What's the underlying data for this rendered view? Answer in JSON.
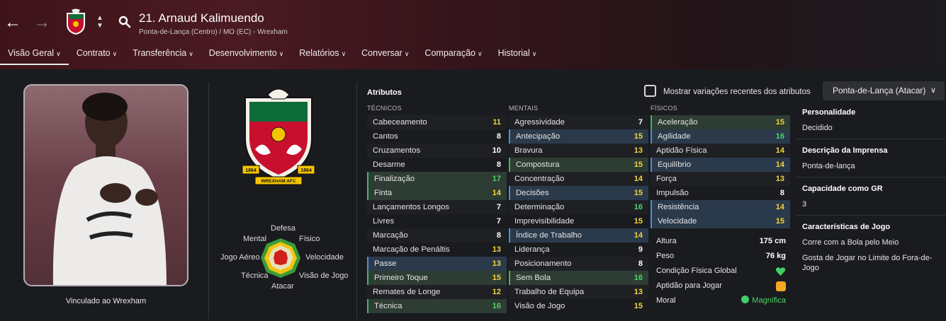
{
  "header": {
    "player_name": "21. Arnaud Kalimuendo",
    "subtitle": "Ponta-de-Lança (Centro) / MO (EC) - Wrexham",
    "back_icon": "back-arrow-icon",
    "forward_icon": "forward-arrow-icon",
    "search_icon": "search-icon"
  },
  "tabs": [
    {
      "label": "Visão Geral"
    },
    {
      "label": "Contrato"
    },
    {
      "label": "Transferência"
    },
    {
      "label": "Desenvolvimento"
    },
    {
      "label": "Relatórios"
    },
    {
      "label": "Conversar"
    },
    {
      "label": "Comparação"
    },
    {
      "label": "Historial"
    }
  ],
  "profile": {
    "caption": "Vinculado ao Wrexham",
    "crest_text": "WREXHAM AFC",
    "crest_years_left": "1864",
    "crest_years_right": "1864"
  },
  "radar": {
    "labels": {
      "defesa": "Defesa",
      "fisico": "Físico",
      "velocidade": "Velocidade",
      "visao": "Visão de Jogo",
      "atacar": "Atacar",
      "tecnica": "Técnica",
      "jogo_aereo": "Jogo Aéreo",
      "mental": "Mental"
    }
  },
  "attributes": {
    "title": "Atributos",
    "show_recent_label": "Mostrar variações recentes dos atributos",
    "role_dropdown": "Ponta-de-Lança (Atacar)",
    "technical_header": "TÉCNICOS",
    "mental_header": "MENTAIS",
    "physical_header": "FÍSICOS",
    "technical": [
      {
        "name": "Cabeceamento",
        "value": "11",
        "color": "yellow",
        "hl": ""
      },
      {
        "name": "Cantos",
        "value": "8",
        "color": "white",
        "hl": ""
      },
      {
        "name": "Cruzamentos",
        "value": "10",
        "color": "white",
        "hl": ""
      },
      {
        "name": "Desarme",
        "value": "8",
        "color": "white",
        "hl": ""
      },
      {
        "name": "Finalização",
        "value": "17",
        "color": "green",
        "hl": "g"
      },
      {
        "name": "Finta",
        "value": "14",
        "color": "yellow",
        "hl": "g"
      },
      {
        "name": "Lançamentos Longos",
        "value": "7",
        "color": "white",
        "hl": ""
      },
      {
        "name": "Livres",
        "value": "7",
        "color": "white",
        "hl": ""
      },
      {
        "name": "Marcação",
        "value": "8",
        "color": "white",
        "hl": ""
      },
      {
        "name": "Marcação de Penáltis",
        "value": "13",
        "color": "yellow",
        "hl": ""
      },
      {
        "name": "Passe",
        "value": "13",
        "color": "yellow",
        "hl": "b"
      },
      {
        "name": "Primeiro Toque",
        "value": "15",
        "color": "yellow",
        "hl": "g"
      },
      {
        "name": "Remates de Longe",
        "value": "12",
        "color": "yellow",
        "hl": ""
      },
      {
        "name": "Técnica",
        "value": "16",
        "color": "green",
        "hl": "g"
      }
    ],
    "mental": [
      {
        "name": "Agressividade",
        "value": "7",
        "color": "white",
        "hl": ""
      },
      {
        "name": "Antecipação",
        "value": "15",
        "color": "yellow",
        "hl": "b"
      },
      {
        "name": "Bravura",
        "value": "13",
        "color": "yellow",
        "hl": ""
      },
      {
        "name": "Compostura",
        "value": "15",
        "color": "yellow",
        "hl": "g"
      },
      {
        "name": "Concentração",
        "value": "14",
        "color": "yellow",
        "hl": ""
      },
      {
        "name": "Decisões",
        "value": "15",
        "color": "yellow",
        "hl": "b"
      },
      {
        "name": "Determinação",
        "value": "16",
        "color": "green",
        "hl": ""
      },
      {
        "name": "Imprevisibilidade",
        "value": "15",
        "color": "yellow",
        "hl": ""
      },
      {
        "name": "Índice de Trabalho",
        "value": "14",
        "color": "yellow",
        "hl": "b"
      },
      {
        "name": "Liderança",
        "value": "9",
        "color": "white",
        "hl": ""
      },
      {
        "name": "Posicionamento",
        "value": "8",
        "color": "white",
        "hl": ""
      },
      {
        "name": "Sem Bola",
        "value": "16",
        "color": "green",
        "hl": "g"
      },
      {
        "name": "Trabalho de Equipa",
        "value": "13",
        "color": "yellow",
        "hl": ""
      },
      {
        "name": "Visão de Jogo",
        "value": "15",
        "color": "yellow",
        "hl": ""
      }
    ],
    "physical": [
      {
        "name": "Aceleração",
        "value": "15",
        "color": "yellow",
        "hl": "g"
      },
      {
        "name": "Agilidade",
        "value": "16",
        "color": "green",
        "hl": "b"
      },
      {
        "name": "Aptidão Física",
        "value": "14",
        "color": "yellow",
        "hl": ""
      },
      {
        "name": "Equilíbrio",
        "value": "14",
        "color": "yellow",
        "hl": "b"
      },
      {
        "name": "Força",
        "value": "13",
        "color": "yellow",
        "hl": ""
      },
      {
        "name": "Impulsão",
        "value": "8",
        "color": "white",
        "hl": ""
      },
      {
        "name": "Resistência",
        "value": "14",
        "color": "yellow",
        "hl": "b"
      },
      {
        "name": "Velocidade",
        "value": "15",
        "color": "yellow",
        "hl": "b"
      }
    ]
  },
  "info": {
    "altura_label": "Altura",
    "altura": "175 cm",
    "peso_label": "Peso",
    "peso": "76 kg",
    "condicao_label": "Condição Física Global",
    "aptidao_label": "Aptidão para Jogar",
    "moral_label": "Moral",
    "moral": "Magnífica"
  },
  "right_panel": {
    "personalidade_h": "Personalidade",
    "personalidade": "Decidido",
    "imprensa_h": "Descrição da Imprensa",
    "imprensa": "Ponta-de-lança",
    "gr_h": "Capacidade como GR",
    "gr": "3",
    "caract_h": "Características de Jogo",
    "caract_1": "Corre com a Bola pelo Meio",
    "caract_2": "Gosta de Jogar no Limite do Fora-de-Jogo"
  },
  "colors": {
    "yellow": "#f2d43a",
    "green": "#4fd36a",
    "blue": "#4f8fd0",
    "header": "#4a1a22"
  }
}
